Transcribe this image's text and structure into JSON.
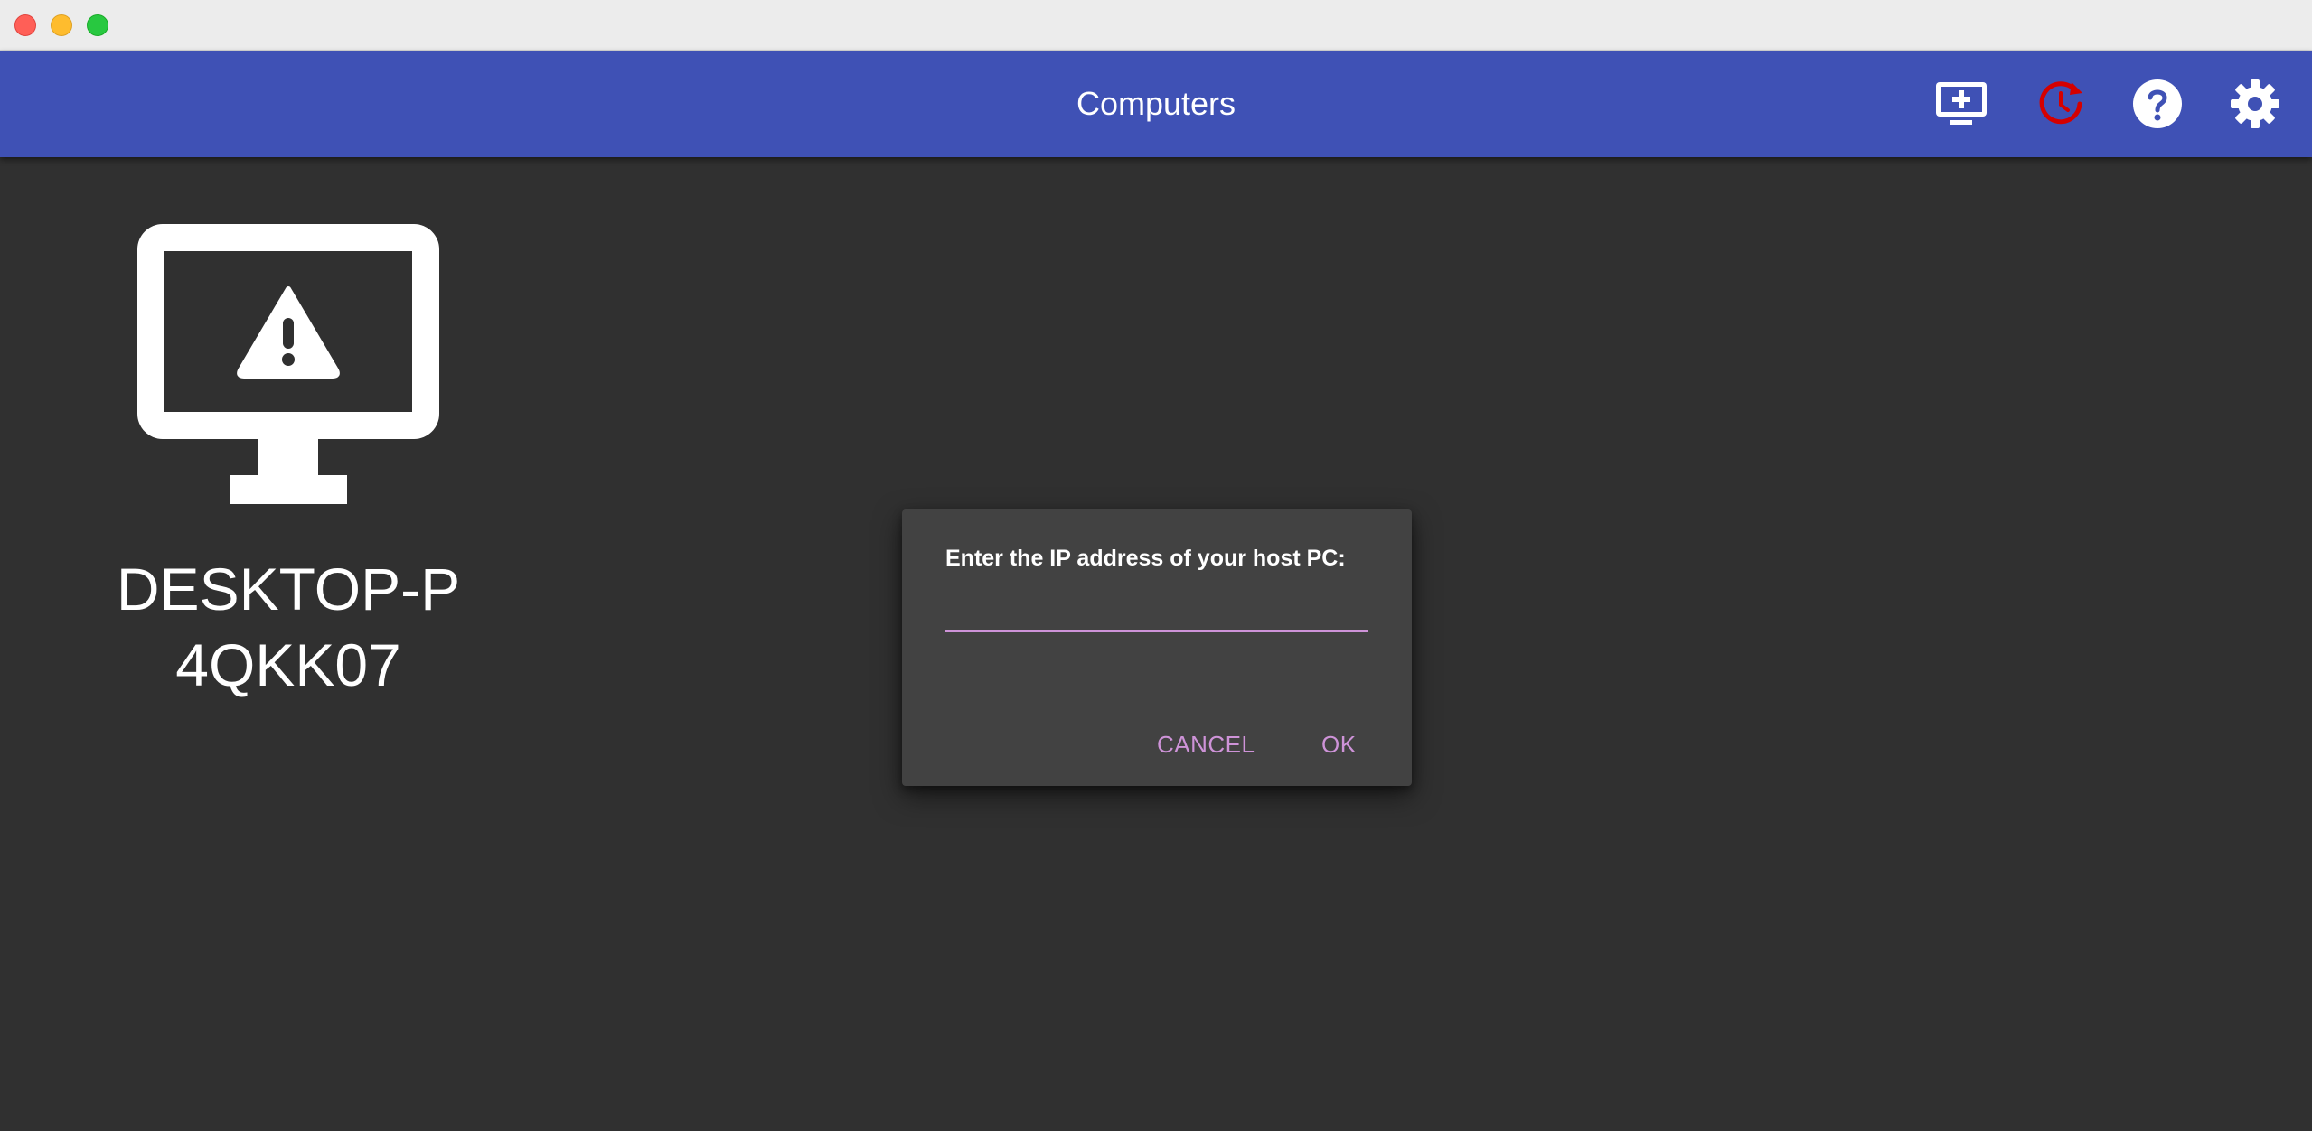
{
  "window": {
    "buttons": [
      "close",
      "minimize",
      "zoom"
    ]
  },
  "appbar": {
    "title": "Computers",
    "actions": [
      {
        "name": "add-pc",
        "icon": "add-computer-icon",
        "color": "#ffffff"
      },
      {
        "name": "recent",
        "icon": "history-icon",
        "color": "#d50000"
      },
      {
        "name": "help",
        "icon": "help-circle-icon",
        "color": "#ffffff"
      },
      {
        "name": "settings",
        "icon": "gear-icon",
        "color": "#ffffff"
      }
    ],
    "background": "#3f51b5"
  },
  "computers": [
    {
      "name": "DESKTOP-P4QKK07",
      "status_icon": "warning-icon"
    }
  ],
  "dialog": {
    "title": "Enter the IP address of your host PC:",
    "input_value": "",
    "cancel_label": "CANCEL",
    "ok_label": "OK",
    "accent": "#ce93d8"
  }
}
